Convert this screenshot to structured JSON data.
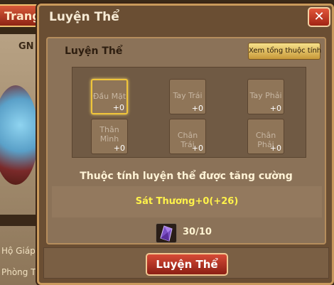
{
  "background": {
    "tab_label": "Trang cá",
    "gn_label": "GN",
    "side_labels": [
      "Hộ Giáp",
      "Phòng Thủ"
    ]
  },
  "dialog": {
    "title": "Luyện Thể",
    "close_icon": "close-icon",
    "section_title": "Luyện Thể",
    "view_all_button": "Xem tổng thuộc tính",
    "slots": [
      {
        "name": "Đầu Mặt",
        "level": "+0",
        "selected": true
      },
      {
        "name": "Tay Trái",
        "level": "+0",
        "selected": false
      },
      {
        "name": "Tay Phải",
        "level": "+0",
        "selected": false
      },
      {
        "name": "Thân\nMình",
        "level": "+0",
        "selected": false
      },
      {
        "name": "Chân Trái",
        "level": "+0",
        "selected": false
      },
      {
        "name": "Chân Phải",
        "level": "+0",
        "selected": false
      }
    ],
    "buff_title": "Thuộc tính luyện thể được tăng cường",
    "buff_value": "Sát Thương+0(+26)",
    "material_icon": "crystal-icon",
    "material_count": "30/10",
    "train_button": "Luyện Thể"
  },
  "colors": {
    "accent_gold": "#f0c53a",
    "buff_yellow": "#fff24a",
    "button_red": "#c43a28"
  }
}
